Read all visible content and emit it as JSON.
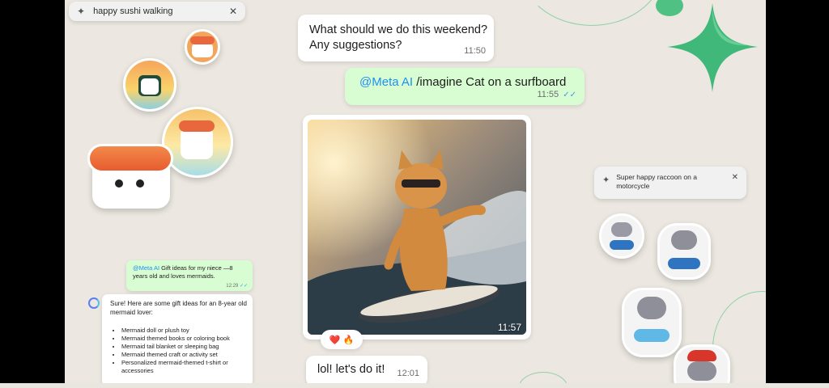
{
  "search_left": {
    "query": "happy sushi walking",
    "close": "✕"
  },
  "search_right": {
    "query": "Super happy raccoon on a motorcycle",
    "close": "✕"
  },
  "chat": {
    "msg1": {
      "text_line1": "What should we do this weekend?",
      "text_line2": "Any suggestions?",
      "time": "11:50"
    },
    "msg2": {
      "mention": "@Meta AI",
      "text": " /imagine Cat on a surfboard",
      "time": "11:55",
      "ticks": "✓✓"
    },
    "image_msg": {
      "time": "11:57",
      "reactions": "❤️ 🔥"
    },
    "msg3": {
      "text": "lol! let's do it!",
      "time": "12:01"
    }
  },
  "side_chat": {
    "request": {
      "mention": "@Meta AI",
      "text": " Gift ideas for my niece —8 years old and loves mermaids.",
      "time": "12:29",
      "ticks": "✓✓"
    },
    "reply": {
      "intro": "Sure! Here are some gift ideas for an 8-year old mermaid lover:",
      "items": [
        "Mermaid doll or plush toy",
        "Mermaid themed books or coloring book",
        "Mermaid tail blanket or sleeping bag",
        "Mermaid themed craft or activity set",
        "Personalized mermaid-themed t-shirt or accessories"
      ]
    }
  },
  "colors": {
    "accent_green": "#d9fdd3",
    "mention_blue": "#1f8ef1",
    "star_green": "#3fb87a",
    "background": "#ece8e1"
  }
}
